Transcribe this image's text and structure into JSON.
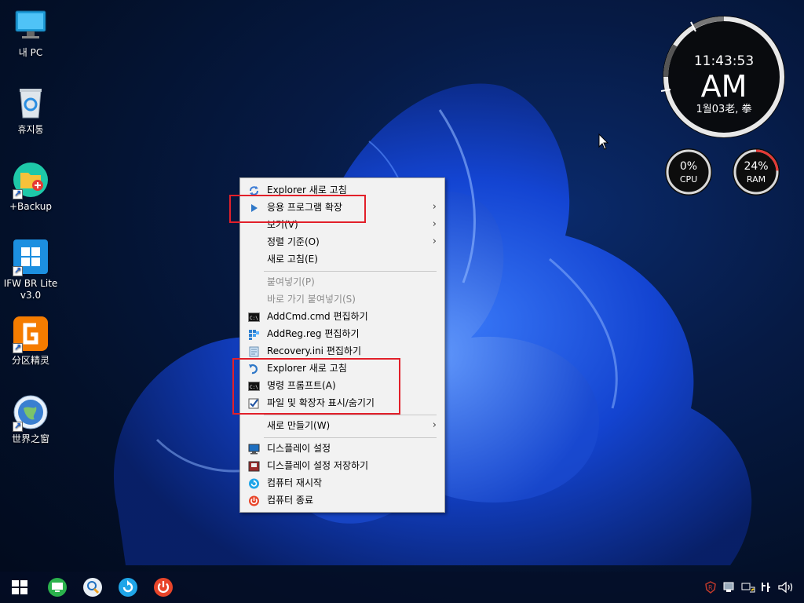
{
  "desktop": {
    "icons": [
      {
        "label": "내 PC",
        "icon": "monitor-icon"
      },
      {
        "label": "휴지통",
        "icon": "recycle-bin-icon"
      },
      {
        "label": "+Backup",
        "icon": "backup-folder-icon"
      },
      {
        "label": "IFW BR Lite v3.0",
        "icon": "windows-logo-icon"
      },
      {
        "label": "分区精灵",
        "icon": "partition-tool-icon"
      },
      {
        "label": "世界之窗",
        "icon": "globe-browser-icon"
      }
    ]
  },
  "context_menu": {
    "items": [
      {
        "label": "Explorer 새로 고침",
        "icon": "refresh-icon"
      },
      {
        "label": "응용 프로그램 확장",
        "icon": "play-arrow-icon",
        "submenu": "›"
      },
      {
        "label": "보기(V)",
        "submenu": "›"
      },
      {
        "label": "정렬 기준(O)",
        "submenu": "›"
      },
      {
        "label": "새로 고침(E)"
      },
      {
        "label": "붙여넣기(P)",
        "disabled": true
      },
      {
        "label": "바로 가기 붙여넣기(S)",
        "disabled": true
      },
      {
        "label": "AddCmd.cmd 편집하기",
        "icon": "cmd-icon"
      },
      {
        "label": "AddReg.reg 편집하기",
        "icon": "registry-icon"
      },
      {
        "label": "Recovery.ini 편집하기",
        "icon": "notepad-icon"
      },
      {
        "label": "Explorer 새로 고침",
        "icon": "explorer-refresh-icon"
      },
      {
        "label": "명령 프롬프트(A)",
        "icon": "cmd-icon"
      },
      {
        "label": "파일 및 확장자 표시/숨기기",
        "icon": "checkbox-icon"
      },
      {
        "label": "새로 만들기(W)",
        "submenu": "›"
      },
      {
        "label": "디스플레이 설정",
        "icon": "display-icon"
      },
      {
        "label": "디스플레이 설정 저장하기",
        "icon": "display-save-icon"
      },
      {
        "label": "컴퓨터 재시작",
        "icon": "restart-icon"
      },
      {
        "label": "컴퓨터 종료",
        "icon": "power-icon"
      }
    ]
  },
  "clock": {
    "time": "11:43:53",
    "ampm": "AM",
    "date": "1월03老, 拳"
  },
  "gauges": {
    "cpu": {
      "value": "0%",
      "label": "CPU",
      "fraction": 0.0
    },
    "ram": {
      "value": "24%",
      "label": "RAM",
      "fraction": 0.24
    }
  },
  "taskbar": {
    "buttons": [
      "start-icon",
      "monitor-app-icon",
      "search-app-icon",
      "refresh-app-icon",
      "power-app-icon"
    ],
    "tray": [
      "security-icon",
      "network-icon",
      "sync-icon",
      "language-icon",
      "volume-icon"
    ]
  },
  "colors": {
    "highlight": "#e2202a",
    "menu_bg": "#f2f2f2",
    "accent": "#1a5fd0"
  }
}
